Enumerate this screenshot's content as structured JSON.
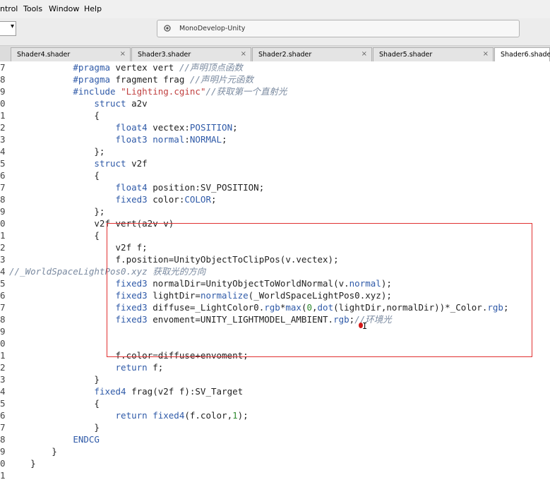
{
  "menu": {
    "items": [
      "ntrol",
      "Tools",
      "Window",
      "Help"
    ]
  },
  "toolbar": {
    "status_text": "MonoDevelop-Unity",
    "combo_arrow": "▾"
  },
  "tabs": [
    {
      "label": "Shader4.shader",
      "active": false
    },
    {
      "label": "Shader3.shader",
      "active": false
    },
    {
      "label": "Shader2.shader",
      "active": false
    },
    {
      "label": "Shader5.shader",
      "active": false
    },
    {
      "label": "Shader6.shader",
      "active": true
    }
  ],
  "tab_close": "×",
  "code_lines": [
    {
      "gutter": "7",
      "text": "            #pragma vertex vert //声明顶点函数"
    },
    {
      "gutter": "8",
      "text": "            #pragma fragment frag //声明片元函数"
    },
    {
      "gutter": "9",
      "text": "            #include \"Lighting.cginc\"//获取第一个直射光"
    },
    {
      "gutter": "0",
      "text": "                struct a2v"
    },
    {
      "gutter": "1",
      "text": "                {"
    },
    {
      "gutter": "2",
      "text": "                    float4 vectex:POSITION;"
    },
    {
      "gutter": "3",
      "text": "                    float3 normal:NORMAL;"
    },
    {
      "gutter": "4",
      "text": "                };"
    },
    {
      "gutter": "5",
      "text": "                struct v2f"
    },
    {
      "gutter": "6",
      "text": "                {"
    },
    {
      "gutter": "7",
      "text": "                    float4 position:SV_POSITION;"
    },
    {
      "gutter": "8",
      "text": "                    fixed3 color:COLOR;"
    },
    {
      "gutter": "9",
      "text": "                };"
    },
    {
      "gutter": "0",
      "text": "                v2f vert(a2v v)"
    },
    {
      "gutter": "1",
      "text": "                {"
    },
    {
      "gutter": "2",
      "text": "                    v2f f;"
    },
    {
      "gutter": "3",
      "text": "                    f.position=UnityObjectToClipPos(v.vectex);"
    },
    {
      "gutter": "4",
      "text": "//_WorldSpaceLightPos0.xyz 获取光的方向"
    },
    {
      "gutter": "5",
      "text": "                    fixed3 normalDir=UnityObjectToWorldNormal(v.normal);"
    },
    {
      "gutter": "6",
      "text": "                    fixed3 lightDir=normalize(_WorldSpaceLightPos0.xyz);"
    },
    {
      "gutter": "7",
      "text": "                    fixed3 diffuse=_LightColor0.rgb*max(0,dot(lightDir,normalDir))*_Color.rgb;"
    },
    {
      "gutter": "8",
      "text": "                    fixed3 envoment=UNITY_LIGHTMODEL_AMBIENT.rgb;//环境光"
    },
    {
      "gutter": "9",
      "text": ""
    },
    {
      "gutter": "0",
      "text": ""
    },
    {
      "gutter": "1",
      "text": "                    f.color=diffuse+envoment;"
    },
    {
      "gutter": "2",
      "text": "                    return f;"
    },
    {
      "gutter": "3",
      "text": "                }"
    },
    {
      "gutter": "4",
      "text": "                fixed4 frag(v2f f):SV_Target"
    },
    {
      "gutter": "5",
      "text": "                {"
    },
    {
      "gutter": "6",
      "text": "                    return fixed4(f.color,1);"
    },
    {
      "gutter": "7",
      "text": "                }"
    },
    {
      "gutter": "8",
      "text": "            ENDCG"
    },
    {
      "gutter": "9",
      "text": "        }"
    },
    {
      "gutter": "0",
      "text": "    }"
    },
    {
      "gutter": "1",
      "text": ""
    }
  ],
  "colors": {
    "keyword": "#2f5aa8",
    "string": "#c04040",
    "comment": "#7a8aa0",
    "number": "#2f8a2f",
    "highlight_box": "#e03030"
  }
}
